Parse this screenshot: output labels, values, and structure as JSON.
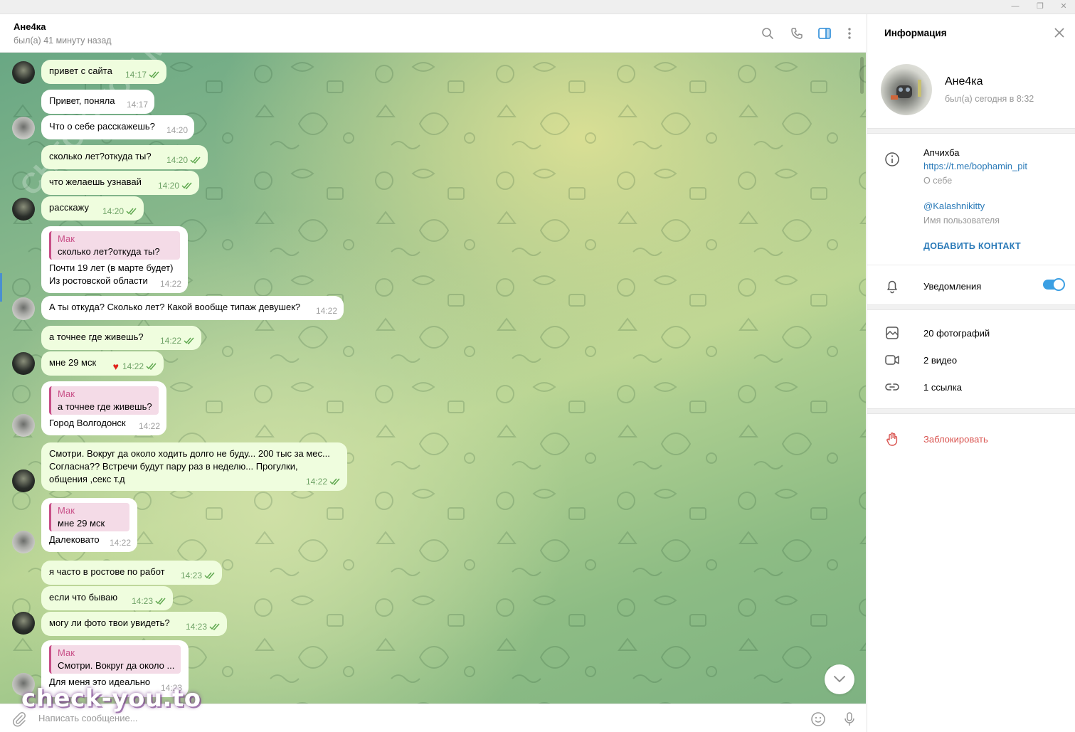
{
  "window": {
    "minimize": "—",
    "restore": "❐"
  },
  "header": {
    "title": "Ане4ка",
    "status": "был(а) 41 минуту назад"
  },
  "messages": [
    {
      "dir": "out",
      "text": "привет с сайта",
      "time": "14:17"
    },
    {
      "dir": "in",
      "text": "Привет, поняла",
      "time": "14:17"
    },
    {
      "dir": "in",
      "text": "Что о себе расскажешь?",
      "time": "14:20"
    },
    {
      "dir": "out",
      "text": "сколько лет?откуда ты?",
      "time": "14:20"
    },
    {
      "dir": "out",
      "text": "что желаешь узнавай",
      "time": "14:20"
    },
    {
      "dir": "out",
      "text": "расскажу",
      "time": "14:20"
    },
    {
      "dir": "in",
      "reply_who": "Мак",
      "reply_text": "сколько лет?откуда ты?",
      "text1": "Почти 19 лет (в марте будет)",
      "text2": "Из ростовской области",
      "time": "14:22"
    },
    {
      "dir": "in",
      "text": "А ты откуда? Сколько лет? Какой вообще типаж девушек?",
      "time": "14:22"
    },
    {
      "dir": "out",
      "text": "а точнее где живешь?",
      "time": "14:22"
    },
    {
      "dir": "out",
      "text": "мне 29 мск",
      "time": "14:22"
    },
    {
      "dir": "in",
      "reply_who": "Мак",
      "reply_text": "а точнее где живешь?",
      "text1": "Город Волгодонск",
      "time": "14:22"
    },
    {
      "dir": "out",
      "text1": "Смотри. Вокруг да около ходить долго не буду... 200 тыс за мес...",
      "text2": "Согласна?? Встречи будут пару раз в неделю... Прогулки,",
      "text3": "общения ,секс  т.д",
      "time": "14:22"
    },
    {
      "dir": "in",
      "reply_who": "Мак",
      "reply_text": "мне 29 мск",
      "text1": "Далековато",
      "time": "14:22"
    },
    {
      "dir": "out",
      "text": "я часто в ростове по работ",
      "time": "14:23"
    },
    {
      "dir": "out",
      "text": "если что бываю",
      "time": "14:23"
    },
    {
      "dir": "out",
      "text": "могу ли фото твои увидеть?",
      "time": "14:23"
    },
    {
      "dir": "in",
      "reply_who": "Мак",
      "reply_text": "Смотри. Вокруг да около ...",
      "text1": "Для меня это идеально",
      "time": "14:23"
    }
  ],
  "watermark": "check-you.to",
  "watermark_diag": "CHECK-YOU.ME",
  "composer": {
    "placeholder": "Написать сообщение..."
  },
  "panel": {
    "title": "Информация",
    "name": "Ане4ка",
    "status": "был(а) сегодня в 8:32",
    "bio": "Апчихба",
    "bio_link": "https://t.me/bophamin_pit",
    "bio_label": "О себе",
    "username": "@Kalashnikitty",
    "username_label": "Имя пользователя",
    "add_contact": "ДОБАВИТЬ КОНТАКТ",
    "notifications": "Уведомления",
    "notifications_on": true,
    "photos": "20 фотографий",
    "videos": "2 видео",
    "links": "1 ссылка",
    "block": "Заблокировать"
  },
  "colors": {
    "accent": "#2a7ab8",
    "outgoing_bubble": "#effdde",
    "incoming_bubble": "#ffffff",
    "reply_accent": "#c84e87",
    "danger": "#d9534f"
  }
}
